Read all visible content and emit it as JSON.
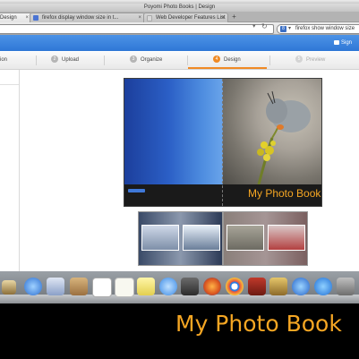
{
  "window": {
    "title": "Poyomi Photo Books | Design"
  },
  "tabs": [
    {
      "label": "Design",
      "active": true
    },
    {
      "label": "firefox display window size in t...",
      "active": false
    },
    {
      "label": "Web Developer Features List",
      "active": false
    }
  ],
  "new_tab_label": "+",
  "search": {
    "value": "firefox show window size",
    "engine_icon": "google-icon"
  },
  "app": {
    "signin_label": "Sign"
  },
  "steps": [
    {
      "number": "",
      "label": "ion",
      "state": "done"
    },
    {
      "number": "2",
      "label": "Upload",
      "state": "done"
    },
    {
      "number": "3",
      "label": "Organize",
      "state": "done"
    },
    {
      "number": "4",
      "label": "Design",
      "state": "active"
    },
    {
      "number": "5",
      "label": "Preview",
      "state": "disabled"
    }
  ],
  "book": {
    "title": "My Photo Book"
  },
  "caption": {
    "text": "My Photo Book"
  },
  "colors": {
    "accent": "#f08a24",
    "title_orange": "#f5a623",
    "app_blue": "#2f77d6"
  },
  "dock_icons": [
    "finder-icon",
    "safari-icon",
    "preview-icon",
    "contacts-icon",
    "calendar-icon",
    "reminders-icon",
    "notes-icon",
    "messages-icon",
    "facetime-icon",
    "firefox-icon",
    "chrome-icon",
    "photo-booth-icon",
    "iphoto-icon",
    "itunes-icon",
    "app-store-icon",
    "system-preferences-icon"
  ]
}
